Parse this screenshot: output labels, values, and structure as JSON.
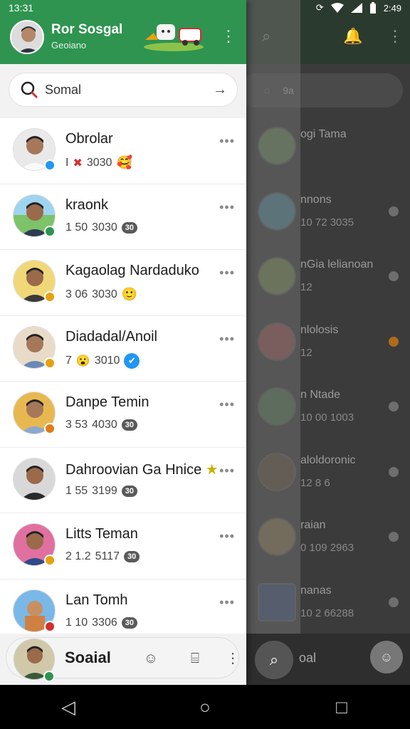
{
  "status_bar": {
    "time_left": "13:31",
    "time_right": "2:49",
    "icons": [
      "sync-icon",
      "wifi-icon",
      "signal-icon",
      "battery-icon"
    ]
  },
  "drawer": {
    "header": {
      "title": "Ror Sosgal",
      "subtitle": "Geoiano",
      "colors": {
        "header_bg": "#2e9450"
      }
    },
    "search": {
      "value": "Somal",
      "placeholder": "Somal"
    },
    "chats": [
      {
        "name": "Obrolar",
        "meta": "I",
        "count": "3030",
        "emoji": "🥰",
        "badge_color": "#2196f3"
      },
      {
        "name": "kraonk",
        "meta": "1 50",
        "count": "3030",
        "tag": "30",
        "badge_color": "#2e9450"
      },
      {
        "name": "Kagaolag Nardaduko",
        "meta": "3 06",
        "count": "3030",
        "emoji": "🙂",
        "badge_color": "#e6a10d"
      },
      {
        "name": "Diadadal/Anoil",
        "meta": "7",
        "count": "3010",
        "emoji": "✔",
        "badge_color": "#e6a10d"
      },
      {
        "name": "Danpe Temin",
        "meta": "3 53",
        "count": "4030",
        "tag": "30",
        "badge_color": "#e07a1a"
      },
      {
        "name": "Dahroovian Ga Hnice",
        "meta": "1 55",
        "count": "3199",
        "tag": "30",
        "badge_color": "#2e9450",
        "star": "★"
      },
      {
        "name": "Litts Teman",
        "meta": "2 1.2",
        "count": "5117",
        "tag": "30",
        "badge_color": "#e6a10d"
      },
      {
        "name": "Lan Tomh",
        "meta": "1 10",
        "count": "3306",
        "tag": "30",
        "badge_color": "#d32f2f"
      }
    ],
    "bottom": {
      "label": "Soaial"
    }
  },
  "background_app": {
    "search_text": "9a",
    "rows": [
      {
        "t1": "ogi Tama",
        "t2": ""
      },
      {
        "t1": "nnons",
        "t2": "10 72 3035"
      },
      {
        "t1": "nGia lelianoan",
        "t2": "12"
      },
      {
        "t1": "nlolosis",
        "t2": "12"
      },
      {
        "t1": "n Ntade",
        "t2": "10 00 1003"
      },
      {
        "t1": "aloldoronic",
        "t2": "12 8 6"
      },
      {
        "t1": "raian",
        "t2": "0 109 2963"
      },
      {
        "t1": "nanas",
        "t2": "10 2 66288"
      }
    ],
    "bottom_label": "oal",
    "dot_colors": [
      "#6e6e6e",
      "#6e6e6e",
      "#6e6e6e",
      "#b06a1a",
      "#6e6e6e",
      "#6e6e6e",
      "#6e6e6e",
      "#6e6e6e"
    ]
  },
  "nav": {
    "back_icon": "back-triangle-icon",
    "home_icon": "home-circle-icon",
    "recents_icon": "recents-square-icon"
  }
}
